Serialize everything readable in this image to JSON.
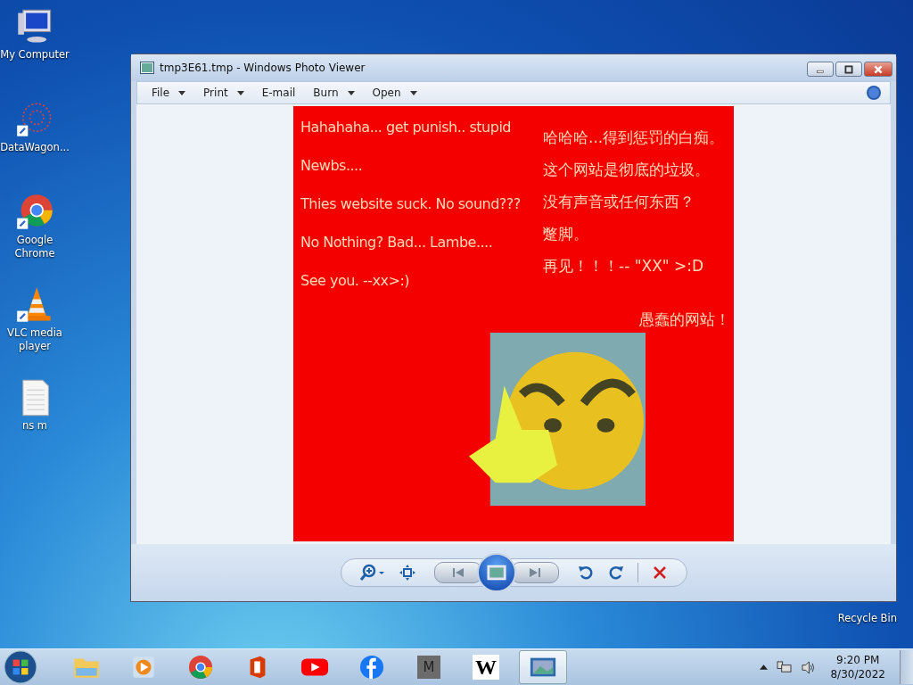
{
  "desktop_icons": [
    {
      "label": "My Computer",
      "kind": "computer"
    },
    {
      "label": "DataWagon...",
      "kind": "web"
    },
    {
      "label": "Google Chrome",
      "kind": "chrome"
    },
    {
      "label": "VLC media player",
      "kind": "vlc"
    },
    {
      "label": "ns m",
      "kind": "file"
    }
  ],
  "recycle_bin": {
    "label": "Recycle Bin"
  },
  "window": {
    "title": "tmp3E61.tmp - Windows Photo Viewer",
    "menu": [
      {
        "label": "File",
        "dropdown": true
      },
      {
        "label": "Print",
        "dropdown": true
      },
      {
        "label": "E-mail",
        "dropdown": false
      },
      {
        "label": "Burn",
        "dropdown": true
      },
      {
        "label": "Open",
        "dropdown": true
      }
    ],
    "image": {
      "lines_left": [
        "Hahahaha... get  punish.. stupid",
        "Newbs....",
        "Thies website suck. No sound???",
        "No Nothing? Bad... Lambe....",
        "See you. --xx>:)"
      ],
      "lines_right": [
        "哈哈哈...得到惩罚的白痴。",
        "这个网站是彻底的垃圾。",
        "没有声音或任何东西？",
        "蹩脚。",
        "再见！！！-- \"XX\" >:D"
      ],
      "caption": "愚蠢的网站！"
    }
  },
  "taskbar": {
    "apps": [
      {
        "kind": "explorer",
        "selected": false
      },
      {
        "kind": "media",
        "selected": false
      },
      {
        "kind": "chrome",
        "selected": false
      },
      {
        "kind": "office",
        "selected": false
      },
      {
        "kind": "youtube",
        "selected": false
      },
      {
        "kind": "facebook",
        "selected": false
      },
      {
        "kind": "m",
        "label": "M",
        "selected": false
      },
      {
        "kind": "wiki",
        "label": "W",
        "selected": false
      },
      {
        "kind": "photo",
        "selected": true
      }
    ],
    "time": "9:20 PM",
    "date": "8/30/2022"
  }
}
